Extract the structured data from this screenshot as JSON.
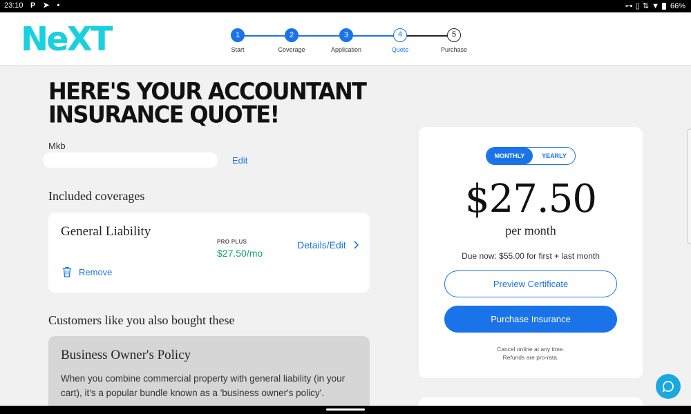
{
  "statusbar": {
    "time": "23:10",
    "left_icons": "P ➤ •",
    "battery": "66%"
  },
  "header": {
    "logo": "NeXT",
    "steps": [
      {
        "num": "1",
        "label": "Start",
        "state": "done"
      },
      {
        "num": "2",
        "label": "Coverage",
        "state": "done"
      },
      {
        "num": "3",
        "label": "Application",
        "state": "done"
      },
      {
        "num": "4",
        "label": "Quote",
        "state": "current"
      },
      {
        "num": "5",
        "label": "Purchase",
        "state": "todo"
      }
    ]
  },
  "main": {
    "headline_line1": "HERE'S YOUR ACCOUNTANT",
    "headline_line2": "INSURANCE QUOTE!",
    "business_name": "Mkb",
    "edit_label": "Edit",
    "included_title": "Included coverages",
    "coverage": {
      "name": "General Liability",
      "tier": "PRO PLUS",
      "price": "$27.50/mo",
      "details_label": "Details/Edit",
      "remove_label": "Remove"
    },
    "also_bought_title": "Customers like you also bought these",
    "bop": {
      "title": "Business Owner's Policy",
      "description": "When you combine commercial property with general liability (in your cart), it's a popular bundle known as a 'business owner's policy'."
    }
  },
  "quote": {
    "toggle_monthly": "MONTHLY",
    "toggle_yearly": "YEARLY",
    "selected": "MONTHLY",
    "price": "$27.50",
    "period": "per month",
    "due_now": "Due now: $55.00 for first + last month",
    "preview_label": "Preview Certificate",
    "purchase_label": "Purchase Insurance",
    "fine_line1": "Cancel online at any time.",
    "fine_line2": "Refunds are pro-rata."
  },
  "colors": {
    "accent": "#1a73e8",
    "brand": "#1ad0e0",
    "price_green": "#1a9e6e",
    "chat": "#1aa8e0"
  },
  "icons": {
    "trash": "trash-icon",
    "chevron": "chevron-right-icon",
    "chat": "chat-bubble-icon"
  }
}
